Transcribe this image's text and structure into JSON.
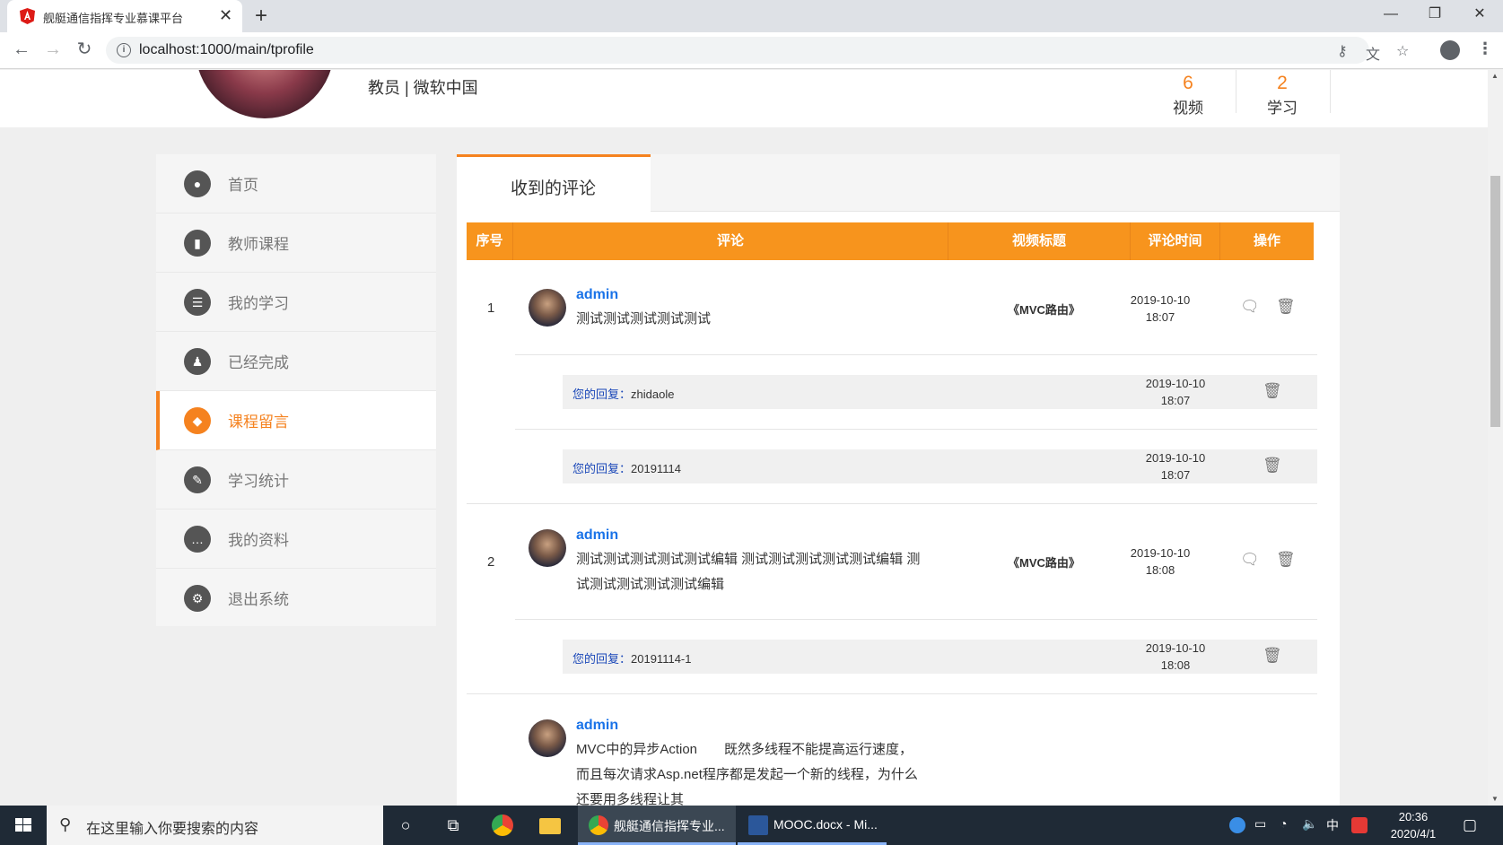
{
  "browser": {
    "tab_title": "舰艇通信指挥专业慕课平台",
    "url": "localhost:1000/main/tprofile"
  },
  "header": {
    "role": "教员 | 微软中国",
    "stats": [
      {
        "num": "6",
        "label": "视频"
      },
      {
        "num": "2",
        "label": "学习"
      }
    ]
  },
  "sidebar": {
    "items": [
      {
        "label": "首页",
        "icon": "user-icon"
      },
      {
        "label": "教师课程",
        "icon": "mic-icon"
      },
      {
        "label": "我的学习",
        "icon": "list-icon"
      },
      {
        "label": "已经完成",
        "icon": "person-icon"
      },
      {
        "label": "课程留言",
        "icon": "tag-icon"
      },
      {
        "label": "学习统计",
        "icon": "pen-icon"
      },
      {
        "label": "我的资料",
        "icon": "chat-icon"
      },
      {
        "label": "退出系统",
        "icon": "gear-icon"
      }
    ]
  },
  "main": {
    "tab": "收到的评论",
    "columns": [
      "序号",
      "评论",
      "视频标题",
      "评论时间",
      "操作"
    ],
    "comments": [
      {
        "index": "1",
        "user": "admin",
        "text_lines": [
          "测试测试测试测试测试"
        ],
        "video": "《MVC路由》",
        "date": "2019-10-10",
        "time": "18:07",
        "replies": [
          {
            "label": "您的回复：",
            "text": "zhidaole",
            "date": "2019-10-10",
            "time": "18:07"
          },
          {
            "label": "您的回复：",
            "text": "20191114",
            "date": "2019-10-10",
            "time": "18:07"
          }
        ]
      },
      {
        "index": "2",
        "user": "admin",
        "text_lines": [
          "测试测试测试测试测试编辑 测试测试测试测试测试编辑 测",
          "试测试测试测试测试编辑"
        ],
        "video": "《MVC路由》",
        "date": "2019-10-10",
        "time": "18:08",
        "replies": [
          {
            "label": "您的回复：",
            "text": "20191114-1",
            "date": "2019-10-10",
            "time": "18:08"
          }
        ]
      },
      {
        "user": "admin",
        "text_lines": [
          "MVC中的异步Action　　既然多线程不能提高运行速度，",
          "而且每次请求Asp.net程序都是发起一个新的线程，为什么",
          "还要用多线程让其"
        ]
      }
    ]
  },
  "taskbar": {
    "search_placeholder": "在这里输入你要搜索的内容",
    "apps": [
      {
        "label": "舰艇通信指挥专业..."
      },
      {
        "label": "MOOC.docx - Mi..."
      }
    ],
    "ime": "中",
    "time": "20:36",
    "date": "2020/4/1"
  },
  "colors": {
    "accent": "#f5821f",
    "table_header": "#f7941d",
    "link": "#1a73e8",
    "reply_label": "#1a47b8"
  }
}
